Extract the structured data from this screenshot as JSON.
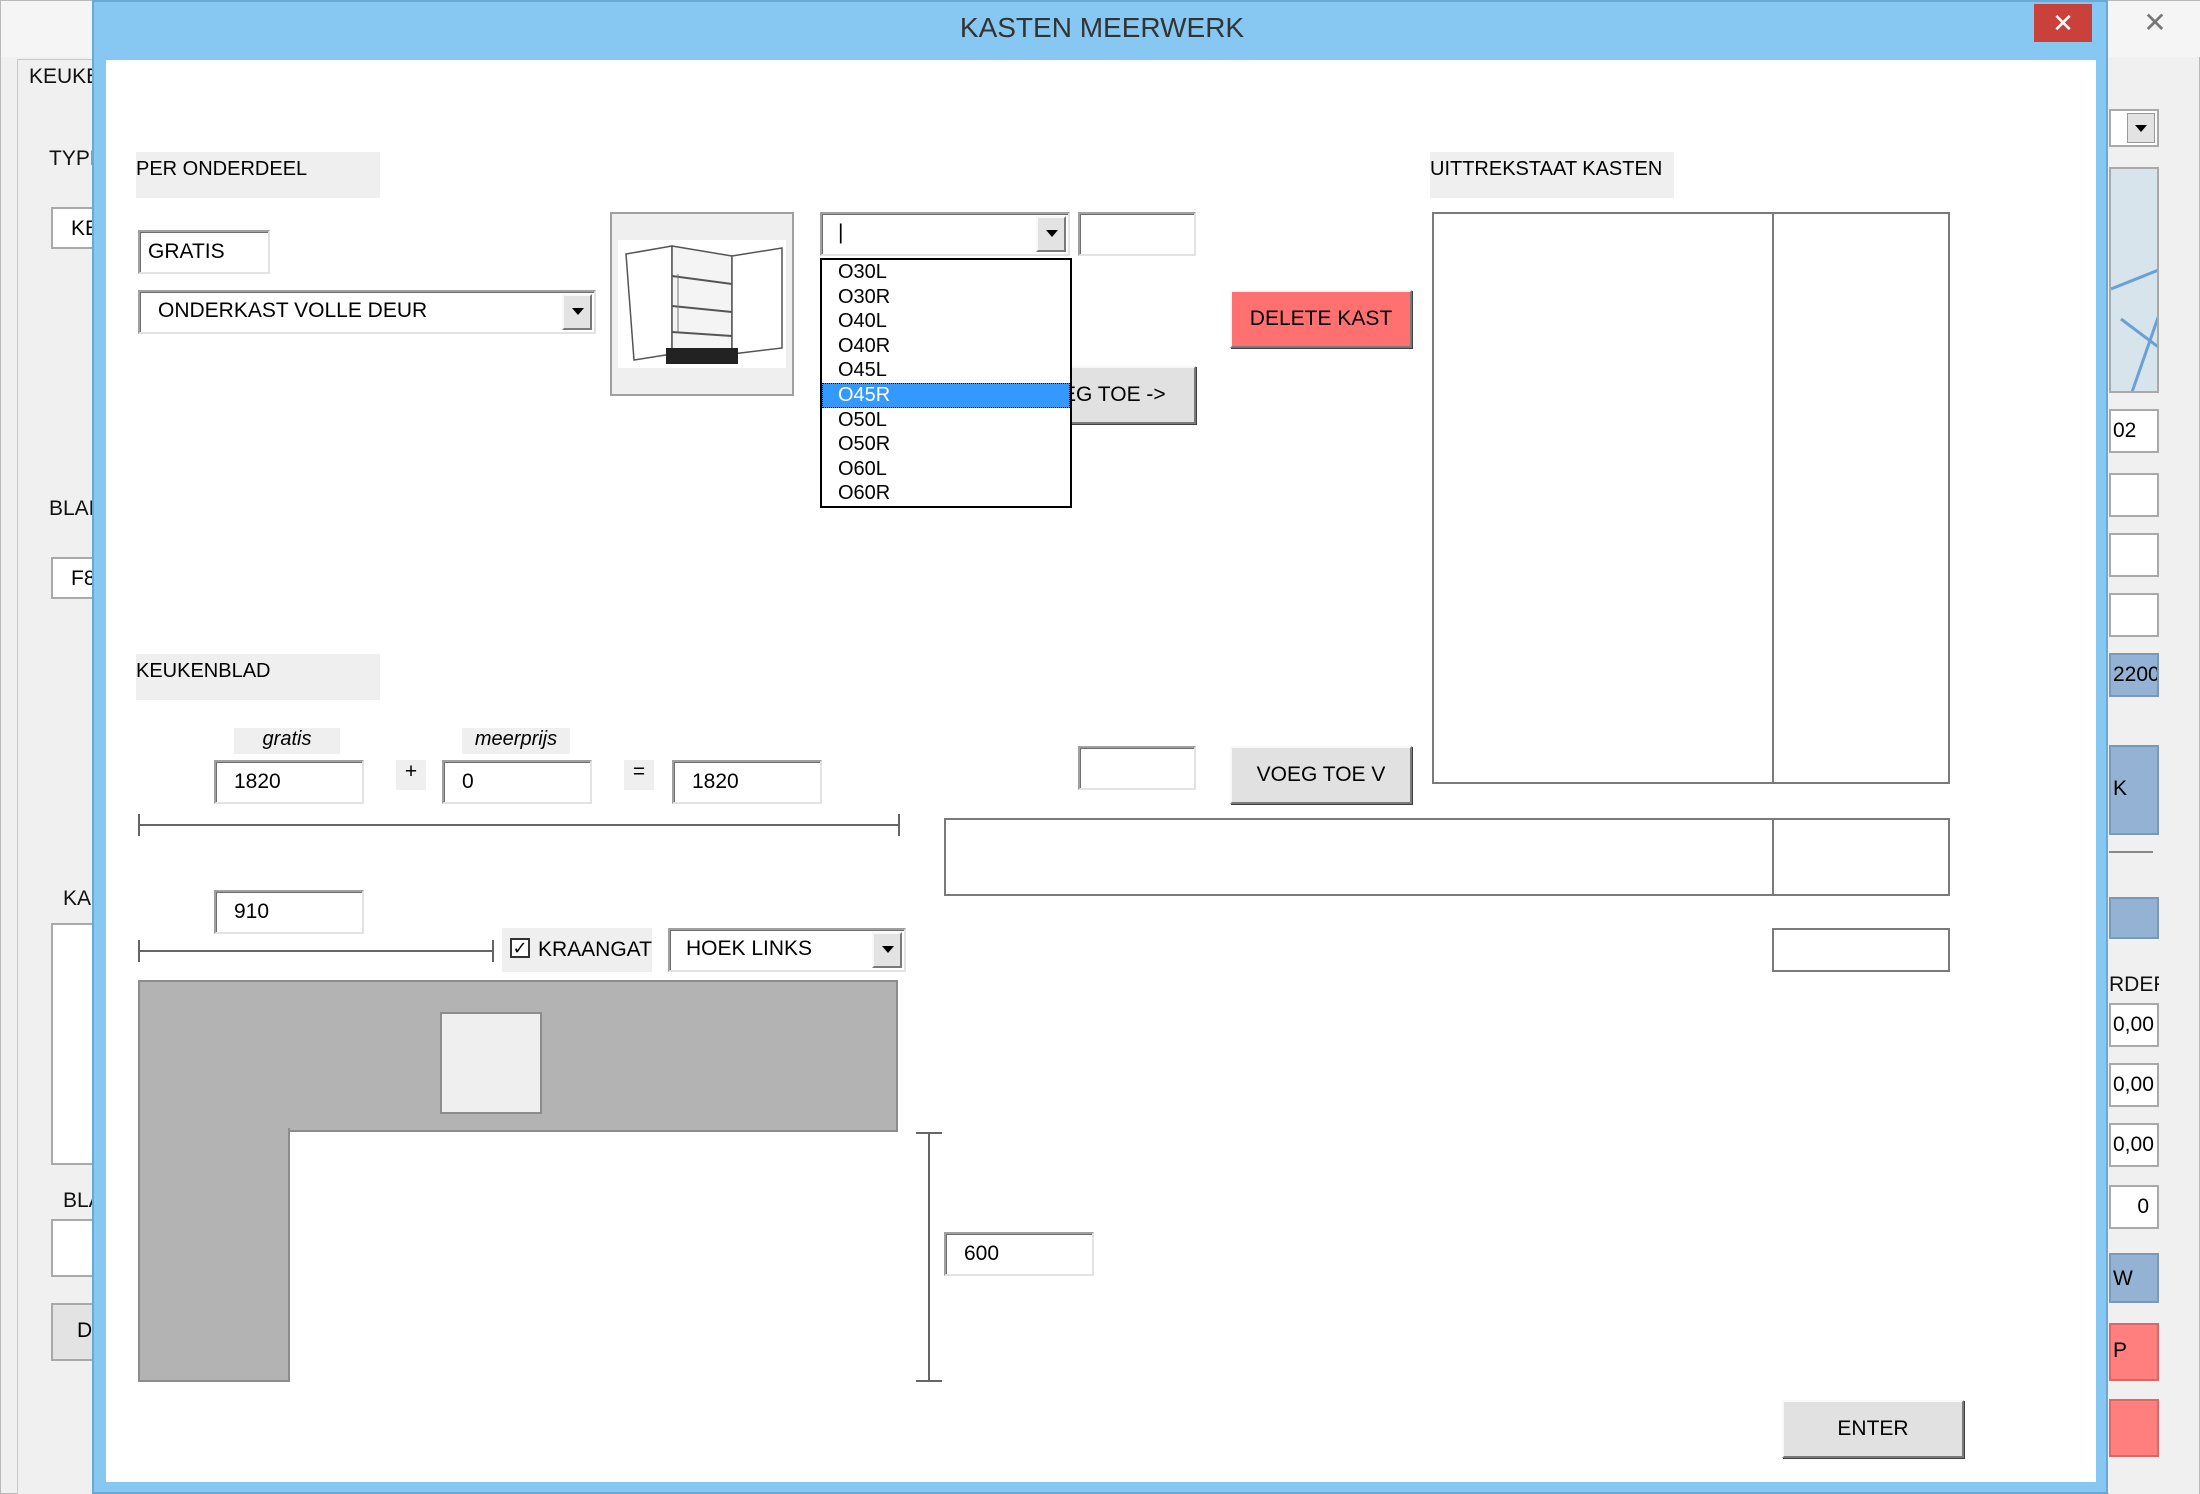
{
  "background": {
    "tab_label": "KEUKEI",
    "type_label": "TYPE",
    "type_value": "KE",
    "blad_label": "BLAD",
    "blad_value": "F8",
    "kas_label": "KA:",
    "bla_label": "BLA",
    "d_button": "D",
    "field_02": "02",
    "field_2200": "2200",
    "blue_k": "K",
    "rder_label": "RDER",
    "money_1": "0,00",
    "money_2": "0,00",
    "money_3": "0,00",
    "zero": "0",
    "w_button": "W",
    "p_button": "P",
    "close": "✕"
  },
  "dialog": {
    "title": "KASTEN MEERWERK",
    "close": "✕"
  },
  "per_onderdeel": {
    "section_label": "PER ONDERDEEL",
    "gratis_label": "GRATIS",
    "type_select": "ONDERKAST VOLLE DEUR",
    "code_select": "|",
    "code_value": "",
    "dropdown_options": [
      "O30L",
      "O30R",
      "O40L",
      "O40R",
      "O45L",
      "O45R",
      "O50L",
      "O50R",
      "O60L",
      "O60R"
    ],
    "selected_option": "O45R",
    "add_button": "VOEG TOE ->",
    "add_button_visible": "EG TOE ->",
    "delete_button": "DELETE KAST"
  },
  "uittrekstaat": {
    "section_label": "UITTREKSTAAT KASTEN"
  },
  "keukenblad": {
    "section_label": "KEUKENBLAD",
    "gratis_label": "gratis",
    "meerprijs_label": "meerprijs",
    "gratis_value": "1820",
    "plus": "+",
    "meerprijs_value": "0",
    "equals": "=",
    "total_value": "1820",
    "width_value": "910",
    "kraangat_checked": true,
    "kraangat_label": "KRAANGAT",
    "hoek_select": "HOEK LINKS",
    "depth_value": "600",
    "small_value": "",
    "voeg_toe_button": "VOEG TOE V"
  },
  "enter_button": "ENTER"
}
